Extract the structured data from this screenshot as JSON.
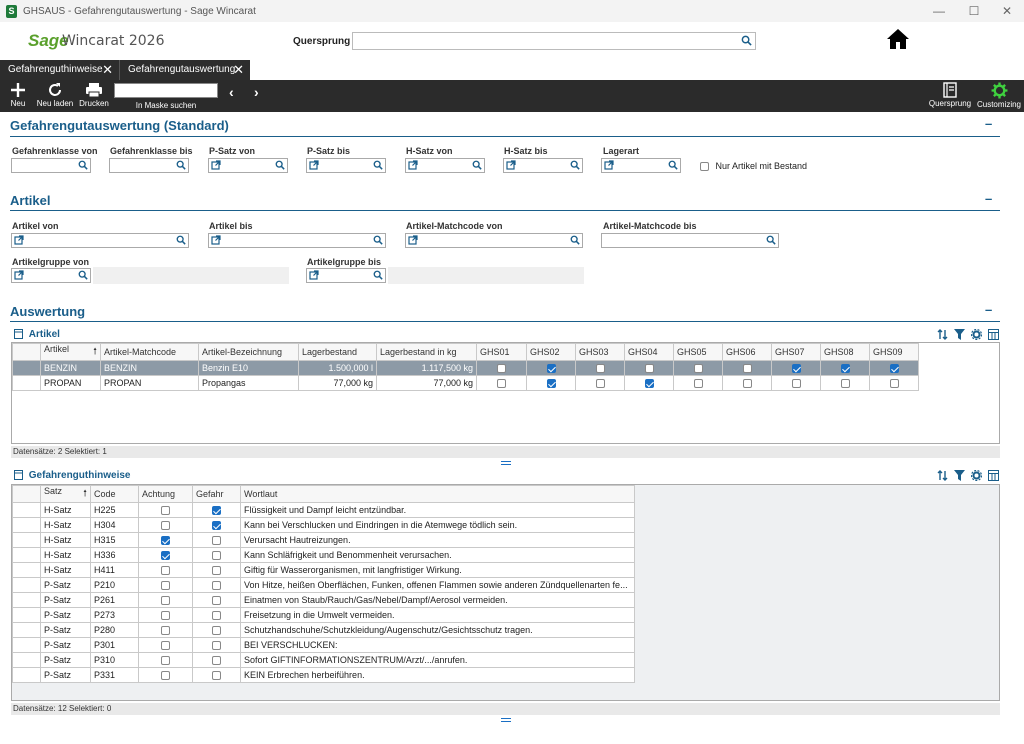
{
  "window": {
    "title": "GHSAUS - Gefahrengutauswertung - Sage Wincarat"
  },
  "header": {
    "logo_brand": "Sage",
    "logo_product": "Wincarat 2026",
    "quersprung_label": "Quersprung",
    "quersprung_value": ""
  },
  "tabs": [
    {
      "label": "Gefahrenguthinweise"
    },
    {
      "label": "Gefahrengutauswertung"
    }
  ],
  "toolbar": {
    "new": "Neu",
    "reload": "Neu laden",
    "print": "Drucken",
    "search_label": "In Maske suchen",
    "quersprung": "Quersprung",
    "customizing": "Customizing"
  },
  "sections": {
    "gefahr": {
      "title": "Gefahrengutauswertung  (Standard)",
      "min": "–",
      "fields": [
        {
          "label": "Gefahrenklasse von"
        },
        {
          "label": "Gefahrenklasse bis"
        },
        {
          "label": "P-Satz von"
        },
        {
          "label": "P-Satz bis"
        },
        {
          "label": "H-Satz von"
        },
        {
          "label": "H-Satz bis"
        },
        {
          "label": "Lagerart"
        }
      ],
      "checkbox_label": "Nur Artikel mit Bestand"
    },
    "artikel": {
      "title": "Artikel",
      "min": "–",
      "artikel_von": "Artikel von",
      "artikel_bis": "Artikel bis",
      "match_von": "Artikel-Matchcode von",
      "match_bis": "Artikel-Matchcode bis",
      "gruppe_von": "Artikelgruppe von",
      "gruppe_bis": "Artikelgruppe bis"
    },
    "auswertung": {
      "title": "Auswertung",
      "min": "–"
    }
  },
  "grid1": {
    "title": "Artikel",
    "columns": [
      "Artikel",
      "Artikel-Matchcode",
      "Artikel-Bezeichnung",
      "Lagerbestand",
      "Lagerbestand in kg",
      "GHS01",
      "GHS02",
      "GHS03",
      "GHS04",
      "GHS05",
      "GHS06",
      "GHS07",
      "GHS08",
      "GHS09"
    ],
    "rows": [
      {
        "artikel": "BENZIN",
        "match": "BENZIN",
        "bez": "Benzin E10",
        "lager": "1.500,000 l",
        "lagerkg": "1.117,500 kg",
        "ghs": [
          false,
          true,
          false,
          false,
          false,
          false,
          true,
          true,
          true
        ]
      },
      {
        "artikel": "PROPAN",
        "match": "PROPAN",
        "bez": "Propangas",
        "lager": "77,000 kg",
        "lagerkg": "77,000 kg",
        "ghs": [
          false,
          true,
          false,
          true,
          false,
          false,
          false,
          false,
          false
        ]
      }
    ],
    "status": "Datensätze: 2   Selektiert: 1"
  },
  "grid2": {
    "title": "Gefahrenguthinweise",
    "columns": [
      "Satz",
      "Code",
      "Achtung",
      "Gefahr",
      "Wortlaut"
    ],
    "rows": [
      {
        "satz": "H-Satz",
        "code": "H225",
        "achtung": false,
        "gefahr": true,
        "text": "Flüssigkeit und Dampf leicht entzündbar."
      },
      {
        "satz": "H-Satz",
        "code": "H304",
        "achtung": false,
        "gefahr": true,
        "text": "Kann bei Verschlucken und Eindringen in die Atemwege tödlich sein."
      },
      {
        "satz": "H-Satz",
        "code": "H315",
        "achtung": true,
        "gefahr": false,
        "text": "Verursacht Hautreizungen."
      },
      {
        "satz": "H-Satz",
        "code": "H336",
        "achtung": true,
        "gefahr": false,
        "text": "Kann Schläfrigkeit und Benommenheit verursachen."
      },
      {
        "satz": "H-Satz",
        "code": "H411",
        "achtung": false,
        "gefahr": false,
        "text": "Giftig für Wasserorganismen, mit langfristiger Wirkung."
      },
      {
        "satz": "P-Satz",
        "code": "P210",
        "achtung": false,
        "gefahr": false,
        "text": "Von Hitze, heißen Oberflächen, Funken, offenen Flammen sowie anderen Zündquellenarten fe..."
      },
      {
        "satz": "P-Satz",
        "code": "P261",
        "achtung": false,
        "gefahr": false,
        "text": "Einatmen von Staub/Rauch/Gas/Nebel/Dampf/Aerosol vermeiden."
      },
      {
        "satz": "P-Satz",
        "code": "P273",
        "achtung": false,
        "gefahr": false,
        "text": "Freisetzung in die Umwelt vermeiden."
      },
      {
        "satz": "P-Satz",
        "code": "P280",
        "achtung": false,
        "gefahr": false,
        "text": "Schutzhandschuhe/Schutzkleidung/Augenschutz/Gesichtsschutz tragen."
      },
      {
        "satz": "P-Satz",
        "code": "P301",
        "achtung": false,
        "gefahr": false,
        "text": "BEI VERSCHLUCKEN:"
      },
      {
        "satz": "P-Satz",
        "code": "P310",
        "achtung": false,
        "gefahr": false,
        "text": "Sofort GIFTINFORMATIONSZENTRUM/Arzt/.../anrufen."
      },
      {
        "satz": "P-Satz",
        "code": "P331",
        "achtung": false,
        "gefahr": false,
        "text": "KEIN Erbrechen herbeiführen."
      }
    ],
    "status": "Datensätze: 12   Selektiert: 0"
  },
  "colors": {
    "accent": "#1a5e8a",
    "toolbar": "#2b2b2b",
    "check": "#1a6fc4",
    "selected_row": "#8d9aa6",
    "brand": "#5aa02c"
  }
}
